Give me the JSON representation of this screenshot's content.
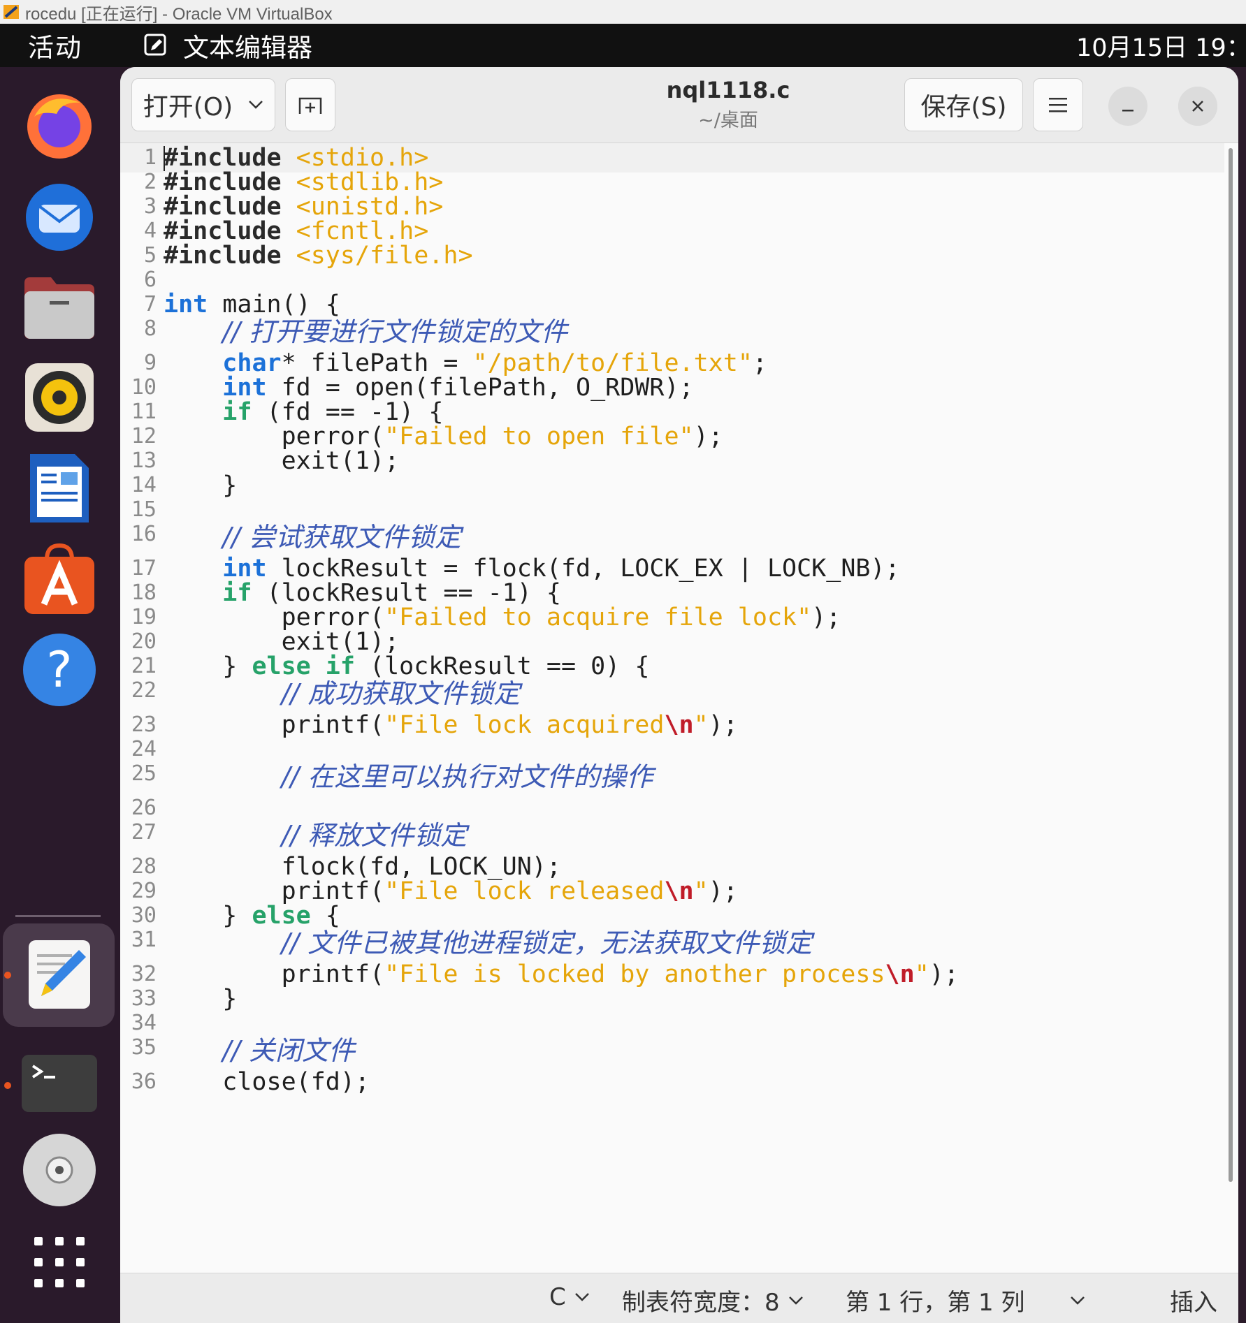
{
  "host_window": {
    "title": "rocedu [正在运行] - Oracle VM VirtualBox"
  },
  "topbar": {
    "activities": "活动",
    "app_name": "文本编辑器",
    "clock": "10月15日  19："
  },
  "dock": {
    "items": [
      "firefox-icon",
      "thunderbird-icon",
      "files-icon",
      "rhythmbox-icon",
      "libreoffice-writer-icon",
      "software-center-icon",
      "help-icon",
      "text-editor-icon",
      "terminal-icon",
      "dvd-icon",
      "show-apps-icon"
    ],
    "active_item": "text-editor-icon",
    "accent": "#e95420"
  },
  "header": {
    "open_label": "打开(O)",
    "file_name": "nql1118.c",
    "file_path": "~/桌面",
    "save_label": "保存(S)"
  },
  "editor": {
    "lines": [
      {
        "n": "1",
        "tokens": [
          [
            "pp",
            "#include"
          ],
          [
            "t",
            " "
          ],
          [
            "inc",
            "<stdio.h>"
          ]
        ]
      },
      {
        "n": "2",
        "tokens": [
          [
            "pp",
            "#include"
          ],
          [
            "t",
            " "
          ],
          [
            "inc",
            "<stdlib.h>"
          ]
        ]
      },
      {
        "n": "3",
        "tokens": [
          [
            "pp",
            "#include"
          ],
          [
            "t",
            " "
          ],
          [
            "inc",
            "<unistd.h>"
          ]
        ]
      },
      {
        "n": "4",
        "tokens": [
          [
            "pp",
            "#include"
          ],
          [
            "t",
            " "
          ],
          [
            "inc",
            "<fcntl.h>"
          ]
        ]
      },
      {
        "n": "5",
        "tokens": [
          [
            "pp",
            "#include"
          ],
          [
            "t",
            " "
          ],
          [
            "inc",
            "<sys/file.h>"
          ]
        ]
      },
      {
        "n": "6",
        "tokens": []
      },
      {
        "n": "7",
        "tokens": [
          [
            "ty",
            "int"
          ],
          [
            "t",
            " main() {"
          ]
        ]
      },
      {
        "n": "8",
        "tokens": [
          [
            "t",
            "    "
          ],
          [
            "cm",
            "// 打开要进行文件锁定的文件"
          ]
        ]
      },
      {
        "n": "9",
        "tokens": [
          [
            "t",
            "    "
          ],
          [
            "ty",
            "char"
          ],
          [
            "t",
            "* filePath = "
          ],
          [
            "str",
            "\"/path/to/file.txt\""
          ],
          [
            "t",
            ";"
          ]
        ]
      },
      {
        "n": "10",
        "tokens": [
          [
            "t",
            "    "
          ],
          [
            "ty",
            "int"
          ],
          [
            "t",
            " fd = open(filePath, O_RDWR);"
          ]
        ]
      },
      {
        "n": "11",
        "tokens": [
          [
            "t",
            "    "
          ],
          [
            "kw",
            "if"
          ],
          [
            "t",
            " (fd == -1) {"
          ]
        ]
      },
      {
        "n": "12",
        "tokens": [
          [
            "t",
            "        perror("
          ],
          [
            "str",
            "\"Failed to open file\""
          ],
          [
            "t",
            ");"
          ]
        ]
      },
      {
        "n": "13",
        "tokens": [
          [
            "t",
            "        exit(1);"
          ]
        ]
      },
      {
        "n": "14",
        "tokens": [
          [
            "t",
            "    }"
          ]
        ]
      },
      {
        "n": "15",
        "tokens": []
      },
      {
        "n": "16",
        "tokens": [
          [
            "t",
            "    "
          ],
          [
            "cm",
            "// 尝试获取文件锁定"
          ]
        ]
      },
      {
        "n": "17",
        "tokens": [
          [
            "t",
            "    "
          ],
          [
            "ty",
            "int"
          ],
          [
            "t",
            " lockResult = flock(fd, LOCK_EX | LOCK_NB);"
          ]
        ]
      },
      {
        "n": "18",
        "tokens": [
          [
            "t",
            "    "
          ],
          [
            "kw",
            "if"
          ],
          [
            "t",
            " (lockResult == -1) {"
          ]
        ]
      },
      {
        "n": "19",
        "tokens": [
          [
            "t",
            "        perror("
          ],
          [
            "str",
            "\"Failed to acquire file lock\""
          ],
          [
            "t",
            ");"
          ]
        ]
      },
      {
        "n": "20",
        "tokens": [
          [
            "t",
            "        exit(1);"
          ]
        ]
      },
      {
        "n": "21",
        "tokens": [
          [
            "t",
            "    } "
          ],
          [
            "kw",
            "else if"
          ],
          [
            "t",
            " (lockResult == 0) {"
          ]
        ]
      },
      {
        "n": "22",
        "tokens": [
          [
            "t",
            "        "
          ],
          [
            "cm",
            "// 成功获取文件锁定"
          ]
        ]
      },
      {
        "n": "23",
        "tokens": [
          [
            "t",
            "        printf("
          ],
          [
            "str",
            "\"File lock acquired"
          ],
          [
            "esc",
            "\\n"
          ],
          [
            "str",
            "\""
          ],
          [
            "t",
            ");"
          ]
        ]
      },
      {
        "n": "24",
        "tokens": []
      },
      {
        "n": "25",
        "tokens": [
          [
            "t",
            "        "
          ],
          [
            "cm",
            "// 在这里可以执行对文件的操作"
          ]
        ]
      },
      {
        "n": "26",
        "tokens": []
      },
      {
        "n": "27",
        "tokens": [
          [
            "t",
            "        "
          ],
          [
            "cm",
            "// 释放文件锁定"
          ]
        ]
      },
      {
        "n": "28",
        "tokens": [
          [
            "t",
            "        flock(fd, LOCK_UN);"
          ]
        ]
      },
      {
        "n": "29",
        "tokens": [
          [
            "t",
            "        printf("
          ],
          [
            "str",
            "\"File lock released"
          ],
          [
            "esc",
            "\\n"
          ],
          [
            "str",
            "\""
          ],
          [
            "t",
            ");"
          ]
        ]
      },
      {
        "n": "30",
        "tokens": [
          [
            "t",
            "    } "
          ],
          [
            "kw",
            "else"
          ],
          [
            "t",
            " {"
          ]
        ]
      },
      {
        "n": "31",
        "tokens": [
          [
            "t",
            "        "
          ],
          [
            "cm",
            "// 文件已被其他进程锁定，无法获取文件锁定"
          ]
        ]
      },
      {
        "n": "32",
        "tokens": [
          [
            "t",
            "        printf("
          ],
          [
            "str",
            "\"File is locked by another process"
          ],
          [
            "esc",
            "\\n"
          ],
          [
            "str",
            "\""
          ],
          [
            "t",
            ");"
          ]
        ]
      },
      {
        "n": "33",
        "tokens": [
          [
            "t",
            "    }"
          ]
        ]
      },
      {
        "n": "34",
        "tokens": []
      },
      {
        "n": "35",
        "tokens": [
          [
            "t",
            "    "
          ],
          [
            "cm",
            "// 关闭文件"
          ]
        ]
      },
      {
        "n": "36",
        "tokens": [
          [
            "t",
            "    close(fd);"
          ]
        ]
      }
    ]
  },
  "statusbar": {
    "language": "C",
    "tab_width": "制表符宽度：8",
    "cursor_pos": "第 1 行，第 1 列",
    "mode": "插入"
  }
}
